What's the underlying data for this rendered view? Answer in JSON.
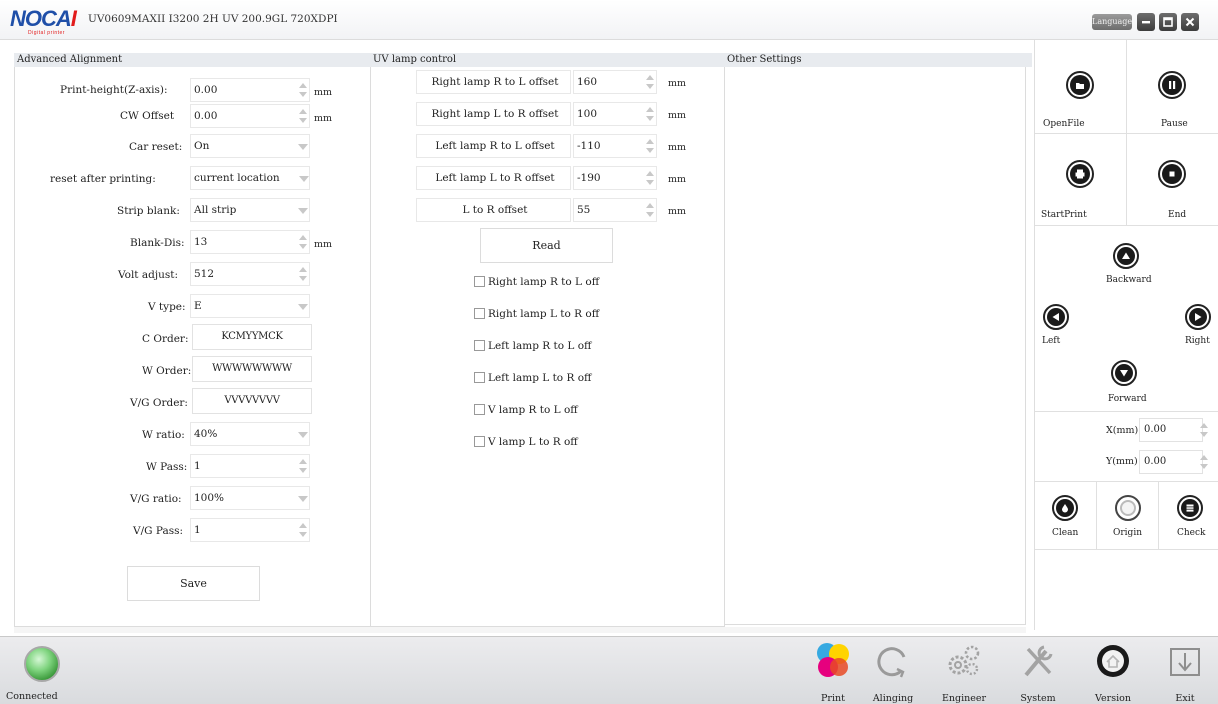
{
  "app": {
    "logo_text": "NOCAI",
    "logo_tagline": "Digital printer",
    "title": "UV0609MAXII I3200 2H UV 200.9GL 720XDPI",
    "language_button": "Language"
  },
  "panels": {
    "advanced_alignment": "Advanced Alignment",
    "uv_lamp_control": "UV lamp control",
    "other_settings": "Other Settings"
  },
  "advanced": {
    "print_height_label": "Print-height(Z-axis):",
    "print_height_value": "0.00",
    "cw_offset_label": "CW Offset",
    "cw_offset_value": "0.00",
    "car_reset_label": "Car reset:",
    "car_reset_value": "On",
    "reset_after_label": "reset after printing:",
    "reset_after_value": "current location",
    "strip_blank_label": "Strip blank:",
    "strip_blank_value": "All strip",
    "blank_dis_label": "Blank-Dis:",
    "blank_dis_value": "13",
    "volt_adjust_label": "Volt adjust:",
    "volt_adjust_value": "512",
    "v_type_label": "V type:",
    "v_type_value": "E",
    "c_order_label": "C Order:",
    "c_order_value": "KCMYYMCK",
    "w_order_label": "W Order:",
    "w_order_value": "WWWWWWWW",
    "vg_order_label": "V/G Order:",
    "vg_order_value": "VVVVVVVV",
    "w_ratio_label": "W ratio:",
    "w_ratio_value": "40%",
    "w_pass_label": "W Pass:",
    "w_pass_value": "1",
    "vg_ratio_label": "V/G ratio:",
    "vg_ratio_value": "100%",
    "vg_pass_label": "V/G Pass:",
    "vg_pass_value": "1",
    "unit_mm": "mm",
    "save_button": "Save"
  },
  "uv": {
    "rows": [
      {
        "label": "Right lamp R to L offset",
        "value": "160",
        "unit": "mm"
      },
      {
        "label": "Right lamp L to R offset",
        "value": "100",
        "unit": "mm"
      },
      {
        "label": "Left lamp R to L offset",
        "value": "-110",
        "unit": "mm"
      },
      {
        "label": "Left lamp L to R offset",
        "value": "-190",
        "unit": "mm"
      },
      {
        "label": "L to R offset",
        "value": "55",
        "unit": "mm"
      }
    ],
    "read_button": "Read",
    "checkboxes": [
      "Right lamp R to L off",
      "Right lamp L to R off",
      "Left lamp R to L off",
      "Left lamp L to R off",
      "V lamp R to L off",
      "V lamp L to R off"
    ]
  },
  "control": {
    "openfile": "OpenFile",
    "pause": "Pause",
    "startprint": "StartPrint",
    "end": "End",
    "backward": "Backward",
    "left": "Left",
    "right": "Right",
    "forward": "Forward",
    "x_label": "X(mm)",
    "x_value": "0.00",
    "y_label": "Y(mm)",
    "y_value": "0.00",
    "clean": "Clean",
    "origin": "Origin",
    "check": "Check"
  },
  "bottom": {
    "connected": "Connected",
    "nav": [
      "Print",
      "Alinging",
      "Engineer",
      "System",
      "Version",
      "Exit"
    ]
  },
  "colors": {
    "brand_blue": "#1f4fa8",
    "brand_red": "#e21b1b",
    "panel_header": "#e8ebef",
    "status_green": "#5bbf5b"
  }
}
